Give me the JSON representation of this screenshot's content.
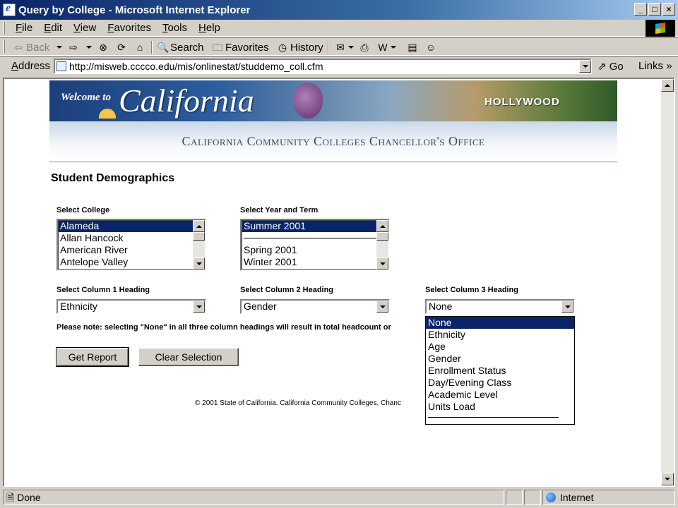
{
  "window": {
    "title": "Query by College - Microsoft Internet Explorer",
    "controls": {
      "minimize": "_",
      "maximize": "□",
      "close": "×"
    }
  },
  "menu": [
    "File",
    "Edit",
    "View",
    "Favorites",
    "Tools",
    "Help"
  ],
  "toolbar": {
    "back": "Back",
    "search": "Search",
    "favorites": "Favorites",
    "history": "History"
  },
  "address": {
    "label": "Address",
    "url": "http://misweb.cccco.edu/mis/onlinestat/studdemo_coll.cfm",
    "go": "Go",
    "links": "Links"
  },
  "banner": {
    "welcome": "Welcome to",
    "state": "California",
    "hollywood": "HOLLYWOOD",
    "office": "California Community Colleges Chancellor's Office"
  },
  "page": {
    "heading": "Student Demographics",
    "select_college": {
      "label": "Select College",
      "options": [
        "Alameda",
        "Allan Hancock",
        "American River",
        "Antelope Valley"
      ],
      "selected_index": 0
    },
    "select_term": {
      "label": "Select Year and Term",
      "options": [
        "Summer 2001",
        "",
        "Spring 2001",
        "Winter 2001"
      ],
      "selected_index": 0
    },
    "col1": {
      "label": "Select Column 1 Heading",
      "value": "Ethnicity"
    },
    "col2": {
      "label": "Select Column 2 Heading",
      "value": "Gender"
    },
    "col3": {
      "label": "Select Column 3 Heading",
      "value": "None",
      "options": [
        "None",
        "Ethnicity",
        "Age",
        "Gender",
        "Enrollment Status",
        "Day/Evening Class",
        "Academic Level",
        "Units Load"
      ],
      "selected_index": 0
    },
    "note": "Please note: selecting \"None\" in all three column headings will result in total headcount or",
    "get_report": "Get Report",
    "clear_selection": "Clear Selection",
    "copyright": "© 2001 State of California. California Community Colleges, Chanc"
  },
  "status": {
    "text": "Done",
    "zone": "Internet"
  }
}
